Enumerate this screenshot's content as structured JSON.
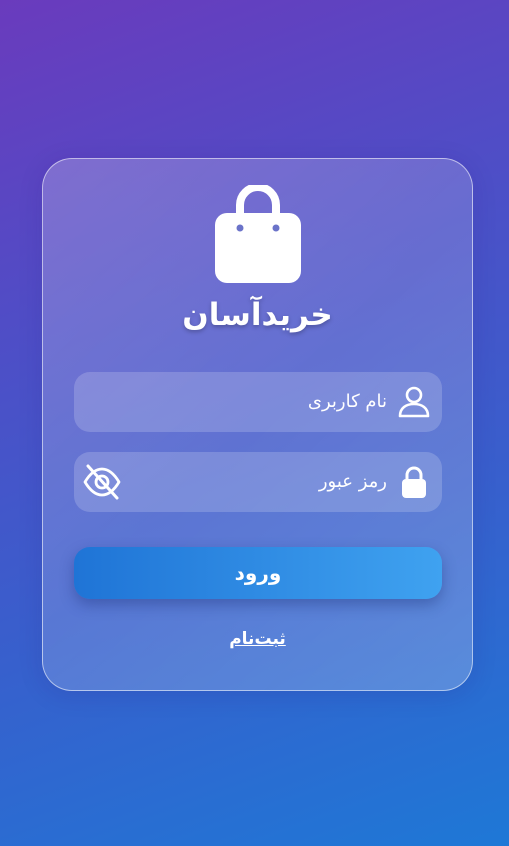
{
  "brand": {
    "title": "خریدآسان",
    "logo_icon": "shopping-bag-icon"
  },
  "form": {
    "username_placeholder": "نام کاربری",
    "username_icon": "user-icon",
    "password_placeholder": "رمز عبور",
    "password_icon": "lock-icon",
    "toggle_visibility_icon": "eye-off-icon",
    "login_label": "ورود",
    "register_link": "ثبت‌نام"
  },
  "colors": {
    "background_top": "#6a3bbd",
    "background_bottom": "#1e78d6",
    "button_start": "#1f74d6",
    "button_end": "#3fa2f0"
  }
}
